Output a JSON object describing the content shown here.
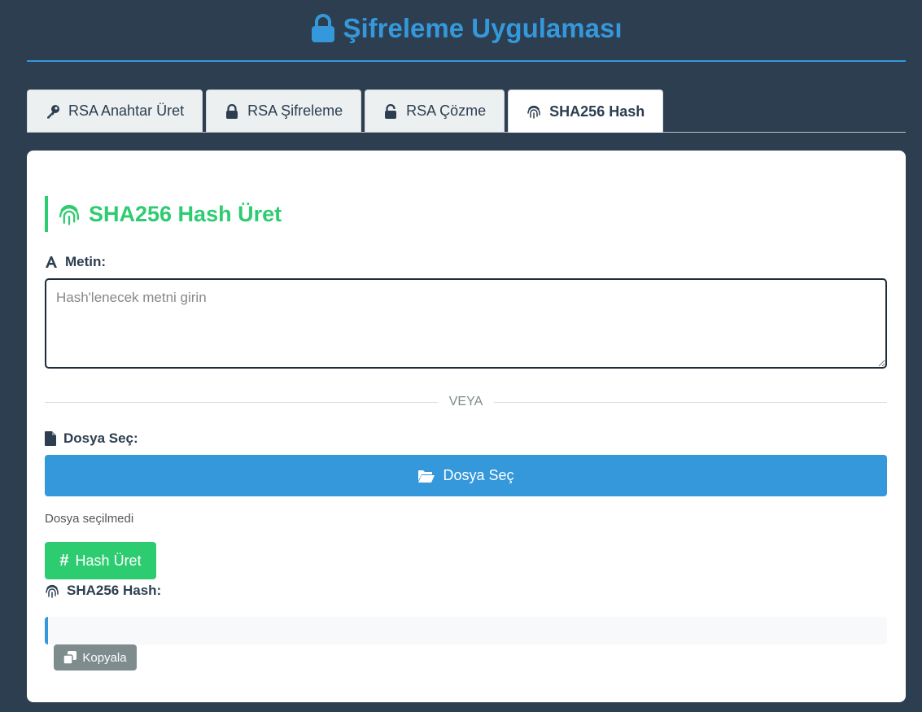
{
  "app": {
    "title": "Şifreleme Uygulaması",
    "accent_color": "#3498db",
    "background_color": "#2c3e50"
  },
  "tabs": [
    {
      "label": "RSA Anahtar Üret",
      "icon": "key-icon",
      "active": false
    },
    {
      "label": "RSA Şifreleme",
      "icon": "lock-icon",
      "active": false
    },
    {
      "label": "RSA Çözme",
      "icon": "unlock-icon",
      "active": false
    },
    {
      "label": "SHA256 Hash",
      "icon": "fingerprint-icon",
      "active": true
    }
  ],
  "panel": {
    "title": "SHA256 Hash Üret",
    "title_color": "#2ecc71",
    "text_label": "Metin:",
    "text_value": "",
    "text_placeholder": "Hash'lenecek metni girin",
    "divider_text": "VEYA",
    "file_label": "Dosya Seç:",
    "file_button": "Dosya Seç",
    "file_status": "Dosya seçilmedi",
    "hash_button": "Hash Üret",
    "result_label": "SHA256 Hash:",
    "result_value": "",
    "copy_button": "Kopyala"
  }
}
